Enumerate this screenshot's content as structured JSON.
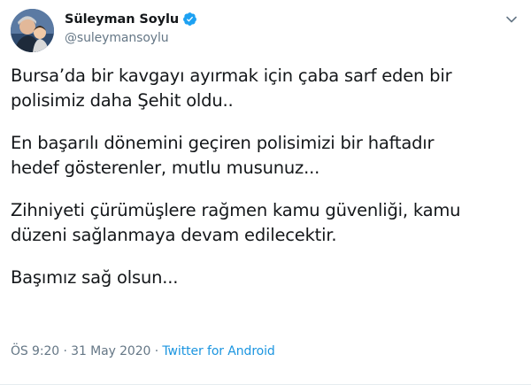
{
  "author": {
    "display_name": "Süleyman Soylu",
    "handle": "@suleymansoylu",
    "verified": true,
    "verified_color": "#1da1f2"
  },
  "tweet": {
    "paragraphs": [
      "Bursa’da bir kavgayı ayırmak için çaba sarf eden bir\npolisimiz daha Şehit oldu..",
      "En başarılı dönemini geçiren polisimizi bir haftadır\nhedef gösterenler, mutlu musunuz...",
      "Zihniyeti çürümüşlere rağmen kamu güvenliği, kamu\ndüzeni sağlanmaya devam edilecektir.",
      "Başımız sağ olsun..."
    ]
  },
  "meta": {
    "time": "ÖS 9:20",
    "date": "31 May 2020",
    "separator": " · ",
    "source": "Twitter for Android",
    "link_color": "#1b95e0"
  },
  "icons": {
    "verified": "verified-badge-icon",
    "menu": "chevron-down-icon"
  }
}
